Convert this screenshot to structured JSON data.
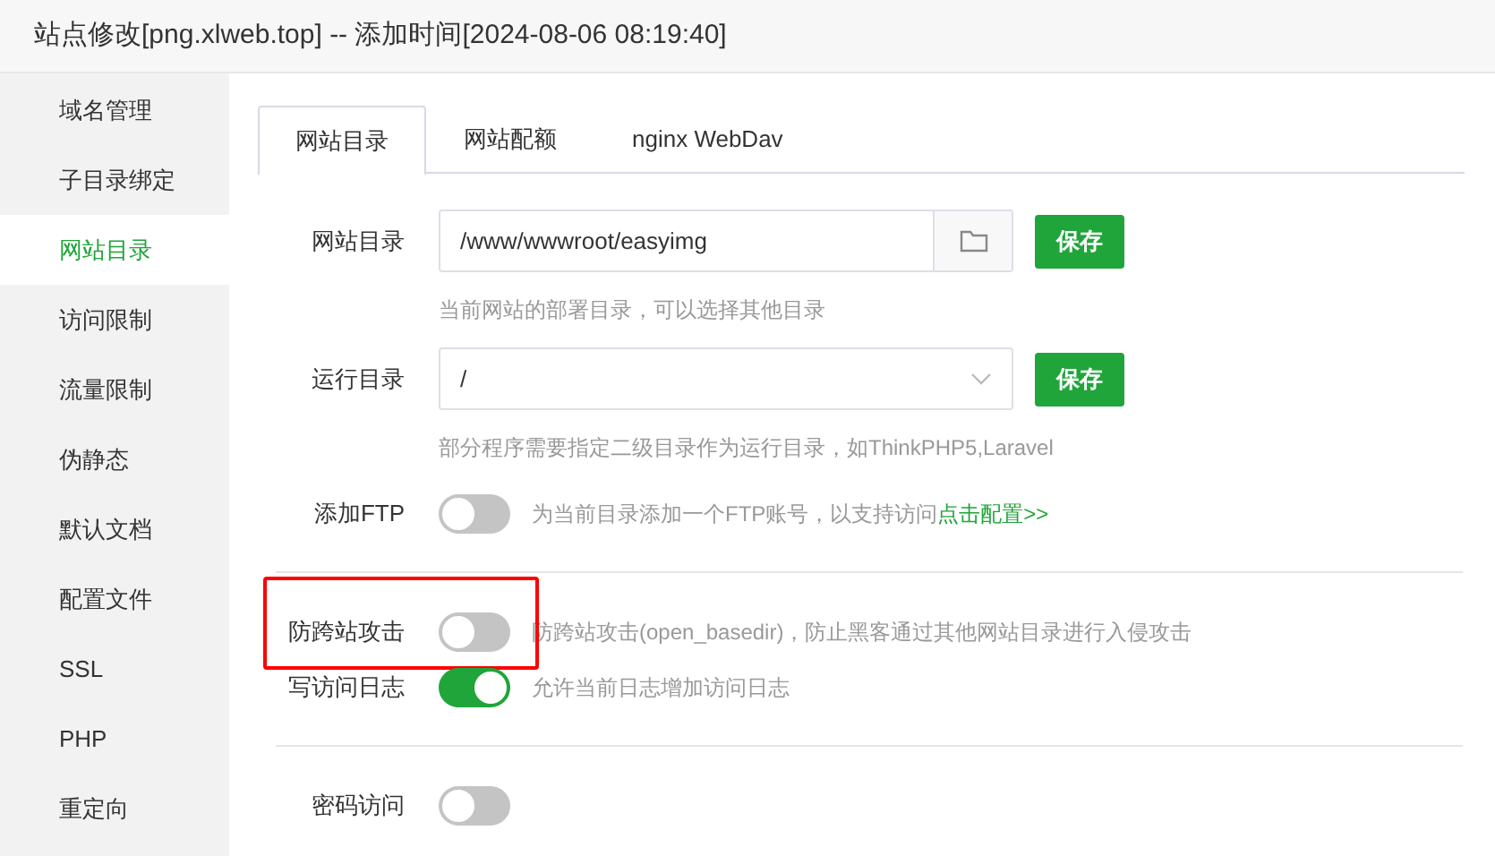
{
  "window": {
    "title": "站点修改[png.xlweb.top] -- 添加时间[2024-08-06 08:19:40]"
  },
  "sidebar": {
    "items": [
      {
        "label": "域名管理",
        "selected": false
      },
      {
        "label": "子目录绑定",
        "selected": false
      },
      {
        "label": "网站目录",
        "selected": true
      },
      {
        "label": "访问限制",
        "selected": false
      },
      {
        "label": "流量限制",
        "selected": false
      },
      {
        "label": "伪静态",
        "selected": false
      },
      {
        "label": "默认文档",
        "selected": false
      },
      {
        "label": "配置文件",
        "selected": false
      },
      {
        "label": "SSL",
        "selected": false
      },
      {
        "label": "PHP",
        "selected": false
      },
      {
        "label": "重定向",
        "selected": false
      }
    ]
  },
  "tabs": [
    {
      "label": "网站目录",
      "selected": true
    },
    {
      "label": "网站配额",
      "selected": false
    },
    {
      "label": "nginx WebDav",
      "selected": false
    }
  ],
  "rows": [
    {
      "kind": "path",
      "label": "网站目录",
      "value": "/www/wwwroot/easyimg",
      "button": "保存",
      "hint": "当前网站的部署目录，可以选择其他目录"
    },
    {
      "kind": "select",
      "label": "运行目录",
      "value": "/",
      "button": "保存",
      "hint": "部分程序需要指定二级目录作为运行目录，如ThinkPHP5,Laravel"
    },
    {
      "kind": "toggle",
      "label": "添加FTP",
      "on": false,
      "description": "为当前目录添加一个FTP账号，以支持访问",
      "link": "点击配置>>",
      "highlighted": false
    },
    {
      "kind": "divider"
    },
    {
      "kind": "toggle",
      "label": "防跨站攻击",
      "on": false,
      "description": "防跨站攻击(open_basedir)，防止黑客通过其他网站目录进行入侵攻击",
      "highlighted": true
    },
    {
      "kind": "toggle",
      "label": "写访问日志",
      "on": true,
      "description": "允许当前日志增加访问日志",
      "highlighted": false
    },
    {
      "kind": "divider"
    },
    {
      "kind": "toggle",
      "label": "密码访问",
      "on": false,
      "highlighted": false
    }
  ]
}
